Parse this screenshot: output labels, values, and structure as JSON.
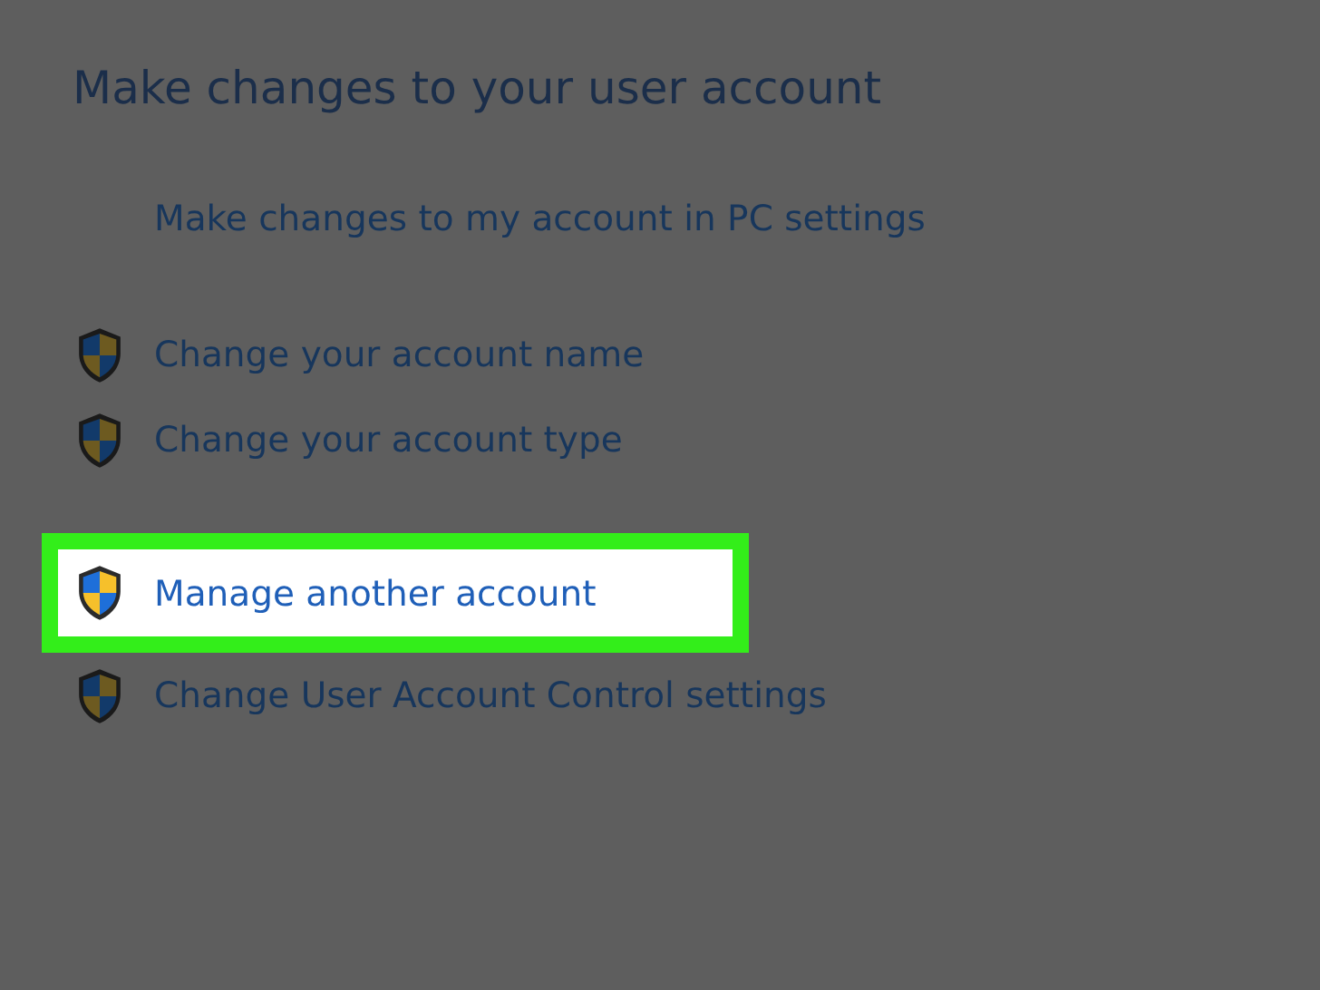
{
  "heading": "Make changes to your user account",
  "groups": [
    {
      "items": [
        {
          "label": "Make changes to my account in PC settings",
          "kind": "plain",
          "highlighted": false
        }
      ]
    },
    {
      "items": [
        {
          "label": "Change your account name",
          "kind": "shield",
          "highlighted": false
        },
        {
          "label": "Change your account type",
          "kind": "shield",
          "highlighted": false
        }
      ]
    },
    {
      "items": [
        {
          "label": "Manage another account",
          "kind": "shield",
          "highlighted": true
        },
        {
          "label": "Change User Account Control settings",
          "kind": "shield",
          "highlighted": false
        }
      ]
    }
  ]
}
